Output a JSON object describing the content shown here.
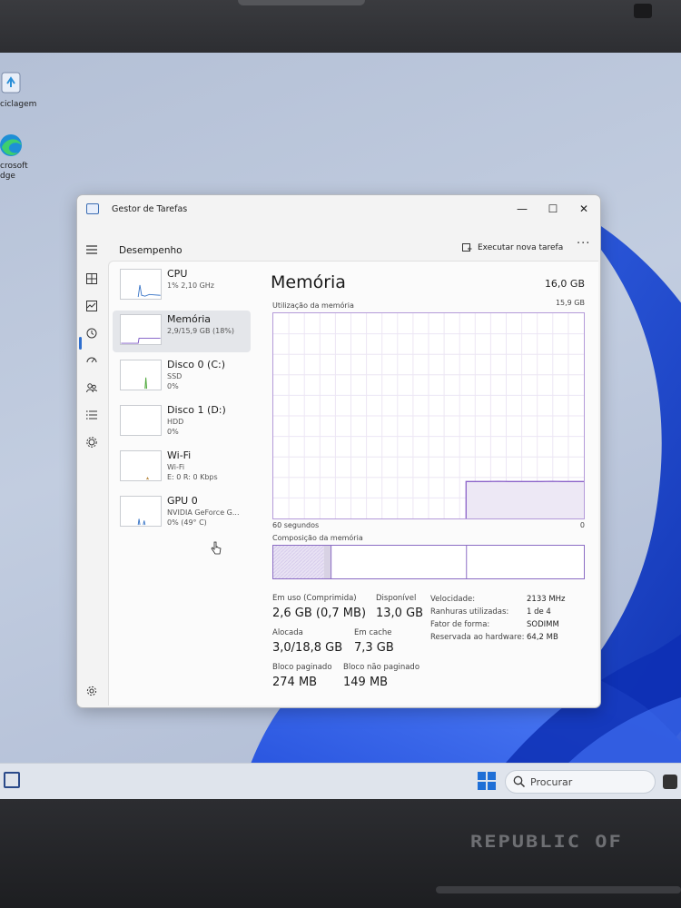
{
  "desktop": {
    "icons": [
      {
        "label_lines": [
          "ciclagem"
        ]
      },
      {
        "label_lines": [
          "crosoft",
          "dge"
        ]
      }
    ]
  },
  "taskbar": {
    "search_placeholder": "Procurar"
  },
  "laptop": {
    "brand_text": "REPUBLIC OF"
  },
  "task_manager": {
    "app_title": "Gestor de Tarefas",
    "window_controls": {
      "minimize": "—",
      "maximize": "☐",
      "close": "✕"
    },
    "page_title": "Desempenho",
    "run_new_task_label": "Executar nova tarefa",
    "more_label": "···",
    "devices": [
      {
        "name": "CPU",
        "sub1": "1% 2,10 GHz",
        "sub2": ""
      },
      {
        "name": "Memória",
        "sub1": "2,9/15,9 GB (18%)",
        "sub2": ""
      },
      {
        "name": "Disco 0 (C:)",
        "sub1": "SSD",
        "sub2": "0%"
      },
      {
        "name": "Disco 1 (D:)",
        "sub1": "HDD",
        "sub2": "0%"
      },
      {
        "name": "Wi-Fi",
        "sub1": "Wi-Fi",
        "sub2": "E: 0 R: 0 Kbps"
      },
      {
        "name": "GPU 0",
        "sub1": "NVIDIA GeForce G...",
        "sub2": "0% (49° C)"
      }
    ],
    "selected_device": "Memória",
    "memory": {
      "title": "Memória",
      "total": "16,0 GB",
      "usage_label": "Utilização da memória",
      "usage_max": "15,9 GB",
      "graph_left": "60 segundos",
      "graph_right": "0",
      "composition_label": "Composição da memória",
      "history_fraction": [
        0,
        0,
        0,
        0,
        0,
        0,
        0,
        0,
        0,
        0,
        0,
        0,
        0,
        0,
        0,
        0,
        0,
        0,
        0.18,
        0.18,
        0.18,
        0.181,
        0.18,
        0.18,
        0.18,
        0.18,
        0.181,
        0.18,
        0.18,
        0.18
      ],
      "stats": {
        "in_use_label": "Em uso (Comprimida)",
        "in_use_value": "2,6 GB (0,7 MB)",
        "available_label": "Disponível",
        "available_value": "13,0 GB",
        "committed_label": "Alocada",
        "committed_value": "3,0/18,8 GB",
        "cached_label": "Em cache",
        "cached_value": "7,3 GB",
        "paged_pool_label": "Bloco paginado",
        "paged_pool_value": "274 MB",
        "nonpaged_pool_label": "Bloco não paginado",
        "nonpaged_pool_value": "149 MB"
      },
      "properties": [
        {
          "key": "Velocidade:",
          "value": "2133 MHz"
        },
        {
          "key": "Ranhuras utilizadas:",
          "value": "1 de 4"
        },
        {
          "key": "Fator de forma:",
          "value": "SODIMM"
        },
        {
          "key": "Reservada ao hardware:",
          "value": "64,2 MB"
        }
      ]
    }
  }
}
